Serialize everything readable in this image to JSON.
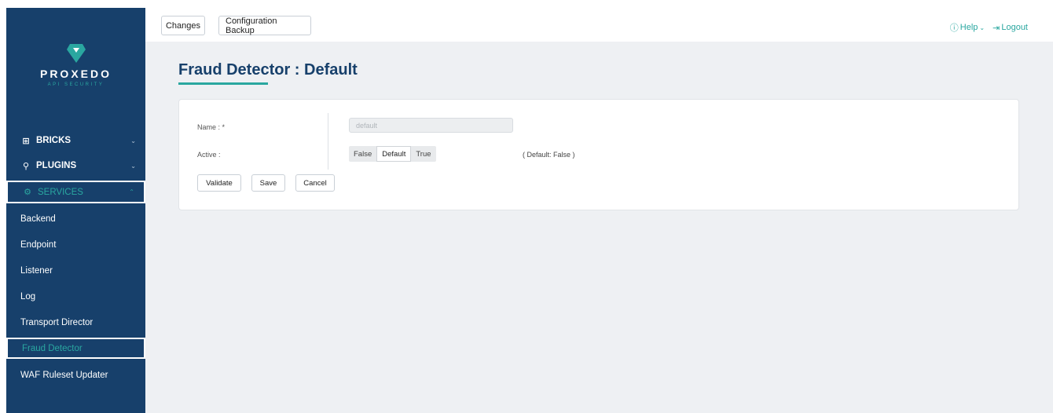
{
  "brand": {
    "name": "PROXEDO",
    "tagline": "API SECURITY",
    "accent": "#2aa7a0",
    "sidebar_bg": "#17406b"
  },
  "sidebar": {
    "sections": [
      {
        "label": "BRICKS",
        "icon": "grid-icon"
      },
      {
        "label": "PLUGINS",
        "icon": "plug-icon"
      },
      {
        "label": "SERVICES",
        "icon": "gear-icon"
      }
    ],
    "service_items": [
      "Backend",
      "Endpoint",
      "Listener",
      "Log",
      "Transport Director",
      "Fraud Detector",
      "WAF Ruleset Updater"
    ],
    "active_item": "Fraud Detector"
  },
  "topbar": {
    "changes_label": "Changes",
    "backup_label": "Configuration Backup",
    "help_label": "Help",
    "logout_label": "Logout"
  },
  "page": {
    "title": "Fraud Detector : Default"
  },
  "form": {
    "name_label": "Name : *",
    "name_value": "default",
    "active_label": "Active :",
    "toggle_options": [
      "False",
      "Default",
      "True"
    ],
    "toggle_selected": "Default",
    "default_note": "( Default: False )",
    "validate_label": "Validate",
    "save_label": "Save",
    "cancel_label": "Cancel"
  }
}
